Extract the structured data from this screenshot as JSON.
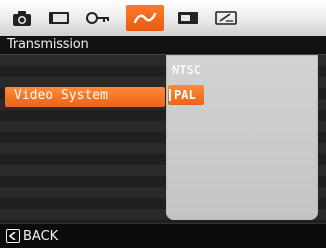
{
  "tabs": [
    {
      "icon": "camera-icon"
    },
    {
      "icon": "screen-icon"
    },
    {
      "icon": "key-icon"
    },
    {
      "icon": "connection-icon",
      "active": true
    },
    {
      "icon": "card-icon"
    },
    {
      "icon": "memo-icon"
    }
  ],
  "header": {
    "title": "Transmission"
  },
  "menu": {
    "selected_item_label": "Video System"
  },
  "options": {
    "items": [
      "NTSC",
      "PAL"
    ],
    "selected": "PAL"
  },
  "footer": {
    "back_label": "BACK",
    "back_icon": "back-icon"
  },
  "colors": {
    "accent": "#ff7a2a",
    "panel": "#c8c8c8",
    "background": "#1a1a1a"
  }
}
